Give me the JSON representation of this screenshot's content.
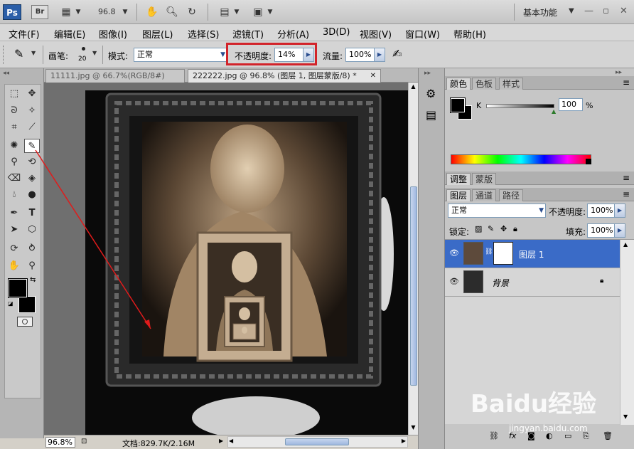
{
  "titlebar": {
    "ps_logo": "Ps",
    "br_logo": "Br",
    "zoom": "96.8",
    "workspace": "基本功能"
  },
  "menu": [
    "文件(F)",
    "编辑(E)",
    "图像(I)",
    "图层(L)",
    "选择(S)",
    "滤镜(T)",
    "分析(A)",
    "3D(D)",
    "视图(V)",
    "窗口(W)",
    "帮助(H)"
  ],
  "options": {
    "brush_label": "画笔:",
    "brush_size": "20",
    "mode_label": "模式:",
    "mode_value": "正常",
    "opacity_label": "不透明度:",
    "opacity_value": "14%",
    "flow_label": "流量:",
    "flow_value": "100%"
  },
  "tabs": [
    {
      "label": "11111.jpg @ 66.7%(RGB/8#)",
      "active": false
    },
    {
      "label": "222222.jpg @ 96.8% (图层 1, 图层蒙版/8) *",
      "active": true
    }
  ],
  "statusbar": {
    "zoom": "96.8%",
    "doc_info": "文档:829.7K/2.16M"
  },
  "color_panel": {
    "tabs": [
      "颜色",
      "色板",
      "样式"
    ],
    "channel": "K",
    "value": "100",
    "unit": "%"
  },
  "adjust_panel": {
    "tabs": [
      "调整",
      "蒙版"
    ]
  },
  "layers_panel": {
    "tabs": [
      "图层",
      "通道",
      "路径"
    ],
    "blend_mode": "正常",
    "opacity_label": "不透明度:",
    "opacity_value": "100%",
    "lock_label": "锁定:",
    "fill_label": "填充:",
    "fill_value": "100%",
    "layers": [
      {
        "name": "图层 1",
        "selected": true
      },
      {
        "name": "背景",
        "selected": false
      }
    ]
  },
  "watermark": {
    "brand": "Baidu经验",
    "url": "jingyan.baidu.com"
  }
}
